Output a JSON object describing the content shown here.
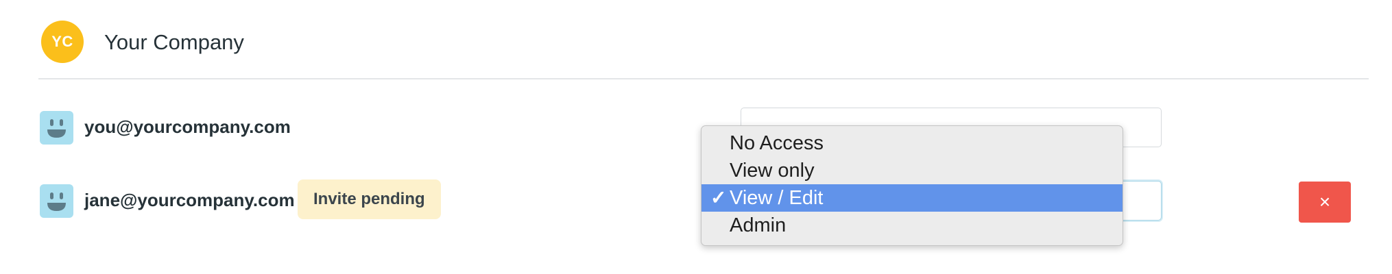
{
  "company": {
    "initials": "YC",
    "name": "Your Company"
  },
  "members": [
    {
      "email": "you@yourcompany.com",
      "avatar_icon": "smiley-face-icon"
    },
    {
      "email": "jane@yourcompany.com",
      "avatar_icon": "smiley-face-icon",
      "badge": "Invite pending",
      "remove_label": "×"
    }
  ],
  "access_menu": {
    "check_mark": "✓",
    "options": [
      {
        "label": "No Access",
        "selected": false
      },
      {
        "label": "View only",
        "selected": false
      },
      {
        "label": "View / Edit",
        "selected": true
      },
      {
        "label": "Admin",
        "selected": false
      }
    ]
  },
  "colors": {
    "company_badge": "#fbbf1b",
    "avatar_bg": "#a9dff0",
    "pending_badge_bg": "#fdf1cc",
    "remove_button": "#f0564b",
    "selected_option": "#6193ea"
  }
}
